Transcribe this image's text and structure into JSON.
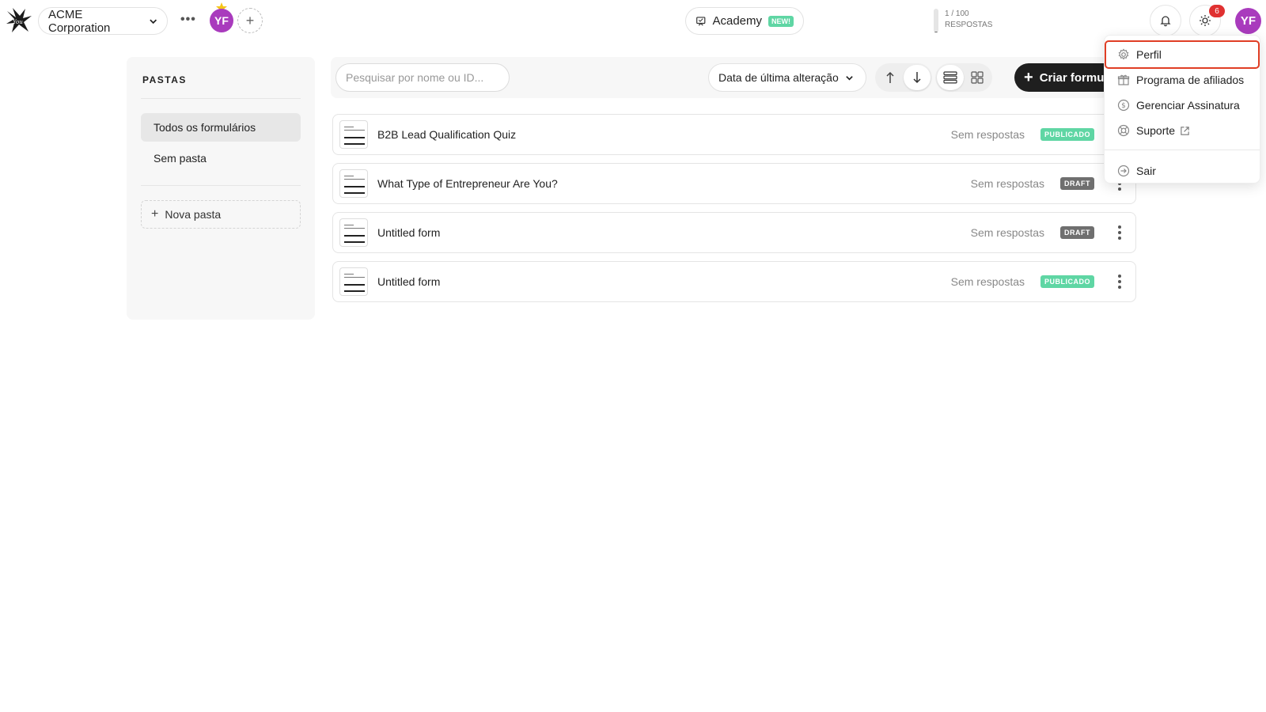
{
  "header": {
    "workspace_name": "ACME Corporation",
    "more_label": "•••",
    "user_initials": "YF",
    "add_member_label": "+",
    "academy_label": "Academy",
    "academy_badge": "NEW!",
    "usage_count": "1 / 100",
    "usage_label": "RESPOSTAS",
    "usage_fraction": 0.01,
    "notifications_count": "6",
    "avatar_color": "#a93bbd"
  },
  "sidebar": {
    "heading": "PASTAS",
    "items": [
      {
        "label": "Todos os formulários"
      },
      {
        "label": "Sem pasta"
      }
    ],
    "new_folder_label": "Nova pasta"
  },
  "toolbar": {
    "search_placeholder": "Pesquisar por nome ou ID...",
    "sort_label": "Data de última alteração",
    "create_label": "Criar formul"
  },
  "forms": [
    {
      "title": "B2B Lead Qualification Quiz",
      "responses": "Sem respostas",
      "status": "PUBLICADO"
    },
    {
      "title": "What Type of Entrepreneur Are You?",
      "responses": "Sem respostas",
      "status": "DRAFT"
    },
    {
      "title": "Untitled form",
      "responses": "Sem respostas",
      "status": "DRAFT"
    },
    {
      "title": "Untitled form",
      "responses": "Sem respostas",
      "status": "PUBLICADO"
    }
  ],
  "user_menu": {
    "items": [
      {
        "label": "Perfil",
        "icon": "gear-icon"
      },
      {
        "label": "Programa de afiliados",
        "icon": "gift-icon"
      },
      {
        "label": "Gerenciar Assinatura",
        "icon": "dollar-icon"
      },
      {
        "label": "Suporte",
        "icon": "lifebuoy-icon"
      }
    ],
    "logout_label": "Sair"
  },
  "colors": {
    "published": "#5fd6a4",
    "draft": "#6f6f6f",
    "highlight": "#e03e25",
    "notification": "#e03131"
  }
}
